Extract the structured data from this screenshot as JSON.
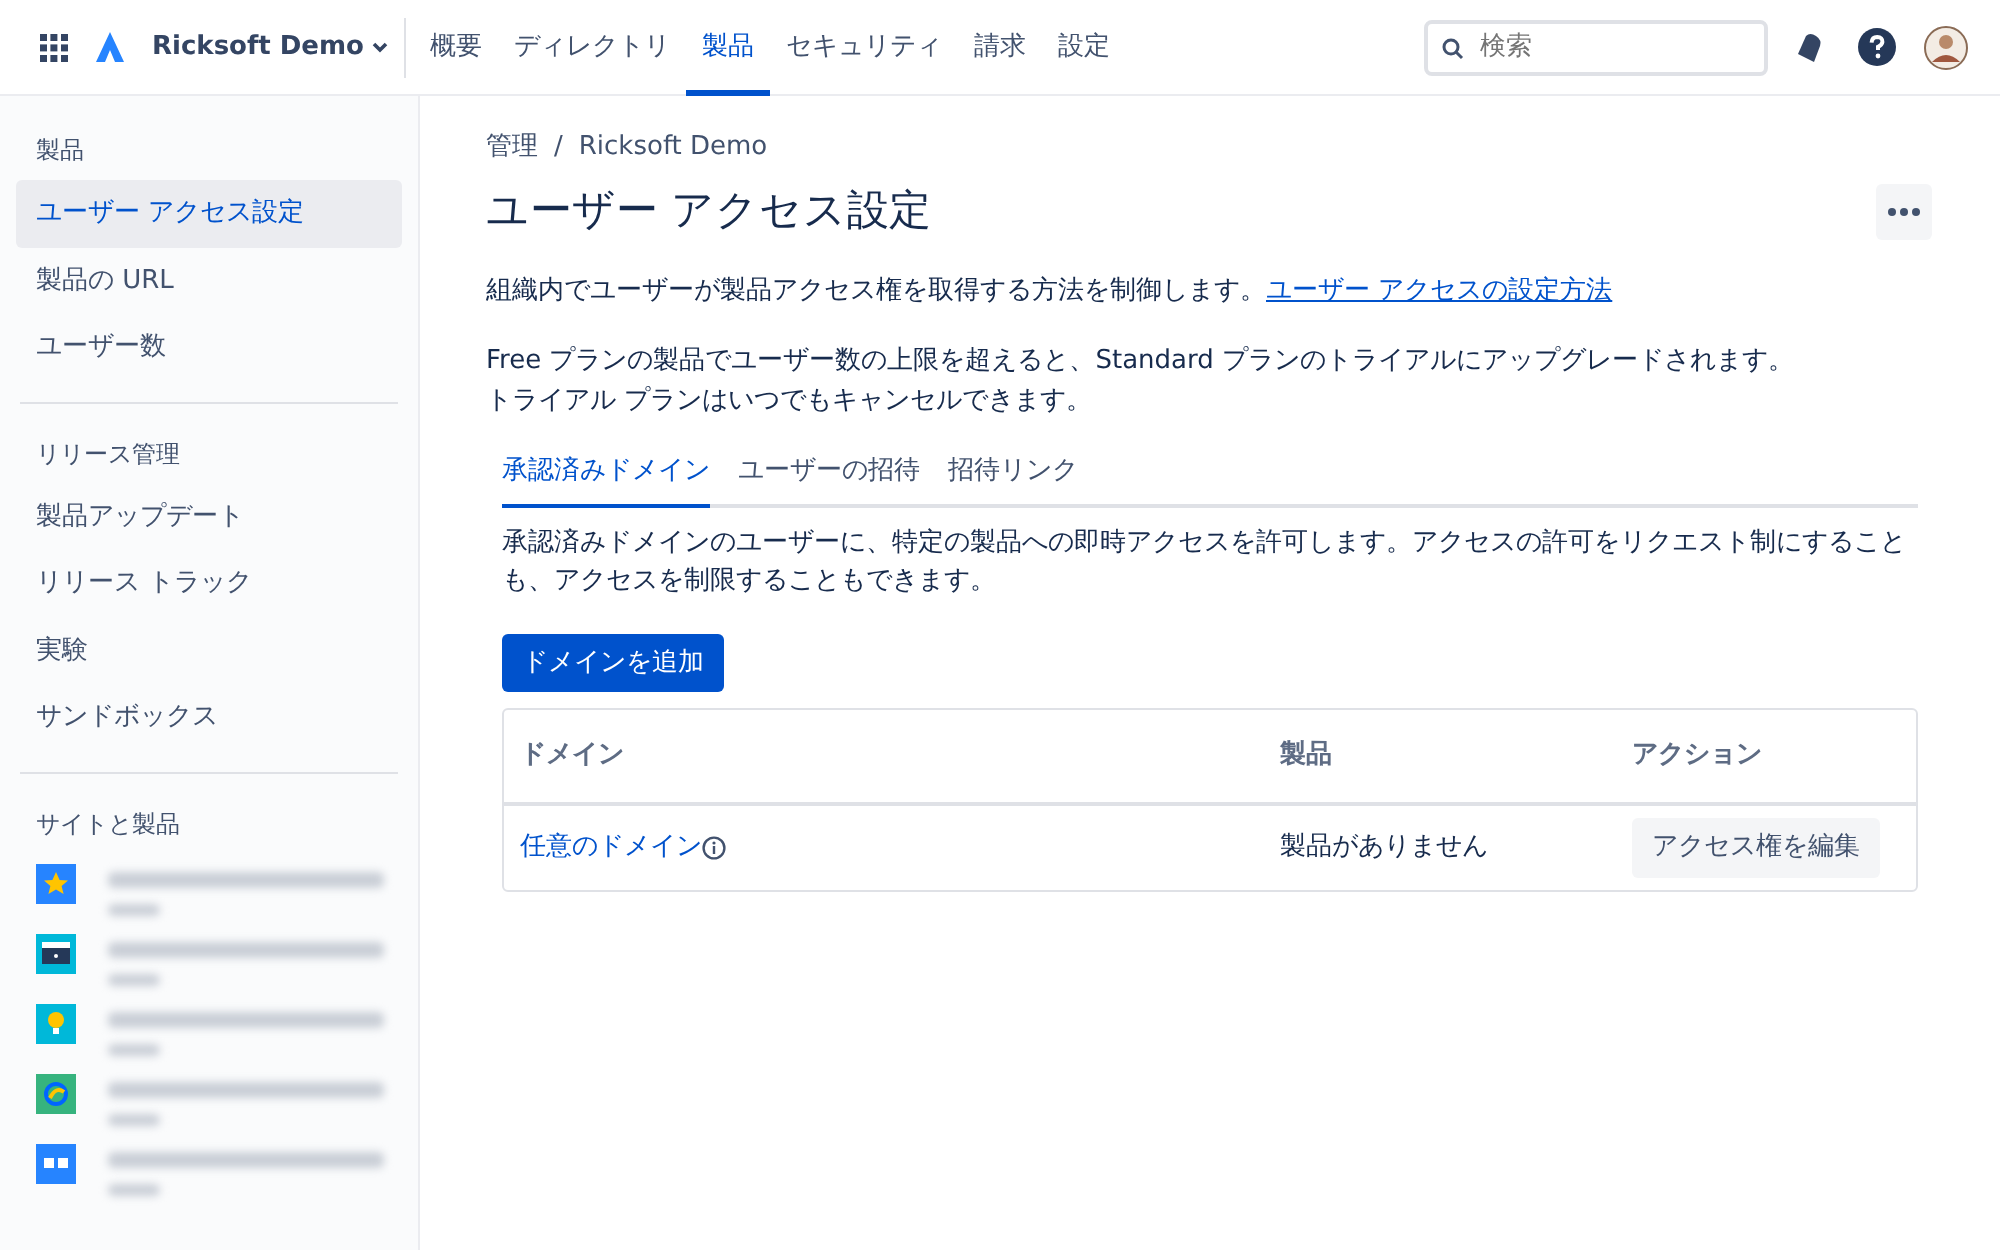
{
  "topbar": {
    "org": "Ricksoft Demo",
    "nav": [
      {
        "label": "概要",
        "selected": false
      },
      {
        "label": "ディレクトリ",
        "selected": false
      },
      {
        "label": "製品",
        "selected": true
      },
      {
        "label": "セキュリティ",
        "selected": false
      },
      {
        "label": "請求",
        "selected": false
      },
      {
        "label": "設定",
        "selected": false
      }
    ],
    "search": {
      "placeholder": "検索"
    }
  },
  "sidebar": {
    "sections": [
      {
        "heading": "製品",
        "items": [
          {
            "label": "ユーザー アクセス設定",
            "selected": true
          },
          {
            "label": "製品の URL",
            "selected": false
          },
          {
            "label": "ユーザー数",
            "selected": false
          }
        ]
      },
      {
        "heading": "リリース管理",
        "items": [
          {
            "label": "製品アップデート",
            "selected": false
          },
          {
            "label": "リリース トラック",
            "selected": false
          },
          {
            "label": "実験",
            "selected": false
          },
          {
            "label": "サンドボックス",
            "selected": false
          }
        ]
      }
    ],
    "sites_heading": "サイトと製品",
    "sites": [
      {
        "kind": "star"
      },
      {
        "kind": "terminal"
      },
      {
        "kind": "bulb"
      },
      {
        "kind": "globe"
      },
      {
        "kind": "box"
      }
    ]
  },
  "main": {
    "breadcrumb": [
      "管理",
      "Ricksoft Demo"
    ],
    "breadcrumb_separator": "/",
    "title": "ユーザー アクセス設定",
    "intro": "組織内でユーザーが製品アクセス権を取得する方法を制御します。",
    "intro_link": "ユーザー アクセスの設定方法",
    "notice": [
      "Free プランの製品でユーザー数の上限を超えると、Standard プランのトライアルにアップグレードされます。",
      "トライアル プランはいつでもキャンセルできます。"
    ],
    "tabs": [
      {
        "label": "承認済みドメイン",
        "selected": true
      },
      {
        "label": "ユーザーの招待",
        "selected": false
      },
      {
        "label": "招待リンク",
        "selected": false
      }
    ],
    "description": "承認済みドメインのユーザーに、特定の製品への即時アクセスを許可します。アクセスの許可をリクエスト制にすることも、アクセスを制限することもできます。",
    "add_button": "ドメインを追加",
    "table": {
      "columns": [
        "ドメイン",
        "製品",
        "アクション"
      ],
      "rows": [
        {
          "domain": "任意のドメイン",
          "products": "製品がありません",
          "action": "アクセス権を編集"
        }
      ]
    }
  }
}
